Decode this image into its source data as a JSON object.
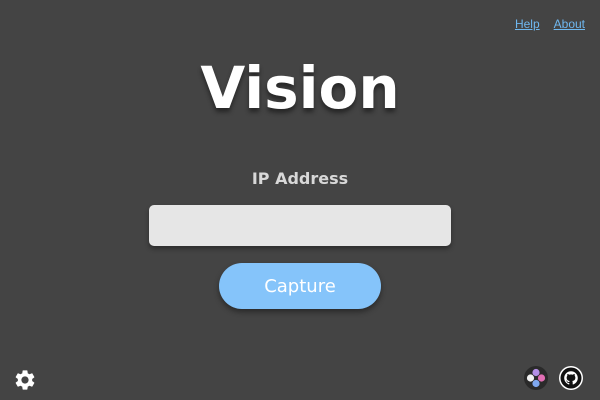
{
  "header": {
    "links": [
      {
        "label": "Help"
      },
      {
        "label": "About"
      }
    ]
  },
  "main": {
    "title": "Vision",
    "ip_label": "IP Address",
    "ip_value": "",
    "capture_label": "Capture"
  },
  "footer": {
    "left_icons": [
      "gear-icon"
    ],
    "right_icons": [
      "app-logo-icon",
      "github-icon"
    ]
  },
  "colors": {
    "background": "#444444",
    "accent": "#85c4fa",
    "link": "#6fb8f0",
    "input_background": "#e6e6e6"
  }
}
